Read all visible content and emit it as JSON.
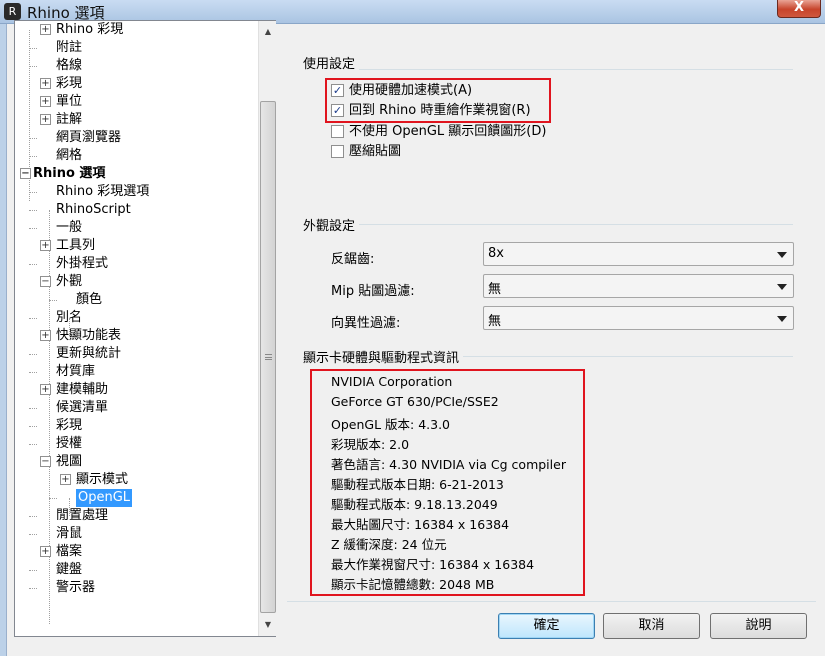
{
  "window": {
    "title": "Rhino 選項",
    "close_label": "X"
  },
  "tree": {
    "items": [
      {
        "label": "Rhino 彩現",
        "expander": "+"
      },
      {
        "label": "附註",
        "expander": ""
      },
      {
        "label": "格線",
        "expander": ""
      },
      {
        "label": "彩現",
        "expander": "+"
      },
      {
        "label": "單位",
        "expander": "+"
      },
      {
        "label": "註解",
        "expander": "+"
      },
      {
        "label": "網頁瀏覽器",
        "expander": ""
      },
      {
        "label": "網格",
        "expander": ""
      },
      {
        "label": "Rhino 選項",
        "expander": "−"
      },
      {
        "label": "Rhino 彩現選項",
        "expander": ""
      },
      {
        "label": "RhinoScript",
        "expander": ""
      },
      {
        "label": "一般",
        "expander": ""
      },
      {
        "label": "工具列",
        "expander": "+"
      },
      {
        "label": "外掛程式",
        "expander": ""
      },
      {
        "label": "外觀",
        "expander": "−"
      },
      {
        "label": "顏色",
        "expander": ""
      },
      {
        "label": "別名",
        "expander": ""
      },
      {
        "label": "快顯功能表",
        "expander": "+"
      },
      {
        "label": "更新與統計",
        "expander": ""
      },
      {
        "label": "材質庫",
        "expander": ""
      },
      {
        "label": "建模輔助",
        "expander": "+"
      },
      {
        "label": "候選清單",
        "expander": ""
      },
      {
        "label": "彩現",
        "expander": ""
      },
      {
        "label": "授權",
        "expander": ""
      },
      {
        "label": "視圖",
        "expander": "−"
      },
      {
        "label": "顯示模式",
        "expander": "+"
      },
      {
        "label": "OpenGL",
        "expander": ""
      },
      {
        "label": "閒置處理",
        "expander": ""
      },
      {
        "label": "滑鼠",
        "expander": ""
      },
      {
        "label": "檔案",
        "expander": "+"
      },
      {
        "label": "鍵盤",
        "expander": ""
      },
      {
        "label": "警示器",
        "expander": ""
      }
    ]
  },
  "usage": {
    "title": "使用設定",
    "options": [
      {
        "label": "使用硬體加速模式(A)",
        "checked": true
      },
      {
        "label": "回到 Rhino 時重繪作業視窗(R)",
        "checked": true
      },
      {
        "label": "不使用 OpenGL 顯示回饋圖形(D)",
        "checked": false
      },
      {
        "label": "壓縮貼圖",
        "checked": false
      }
    ]
  },
  "appearance": {
    "title": "外觀設定",
    "rows": [
      {
        "label": "反鋸齒:",
        "value": "8x"
      },
      {
        "label": "Mip 貼圖過濾:",
        "value": "無"
      },
      {
        "label": "向異性過濾:",
        "value": "無"
      }
    ]
  },
  "gpu_info": {
    "title": "顯示卡硬體與驅動程式資訊",
    "lines": [
      "NVIDIA Corporation",
      "GeForce GT 630/PCIe/SSE2",
      "OpenGL 版本: 4.3.0",
      "彩現版本: 2.0",
      "著色語言: 4.30 NVIDIA via Cg compiler",
      "驅動程式版本日期: 6-21-2013",
      "驅動程式版本: 9.18.13.2049",
      "最大貼圖尺寸: 16384 x 16384",
      "Z 緩衝深度: 24 位元",
      "最大作業視窗尺寸: 16384 x 16384",
      "顯示卡記憶體總數: 2048 MB"
    ]
  },
  "buttons": {
    "ok": "確定",
    "cancel": "取消",
    "help": "說明"
  },
  "colors": {
    "highlight": "#e0141e",
    "selection": "#3399ff"
  },
  "icons": {
    "scroll_up": "▲",
    "scroll_down": "▼",
    "check": "✓",
    "app": "R"
  }
}
